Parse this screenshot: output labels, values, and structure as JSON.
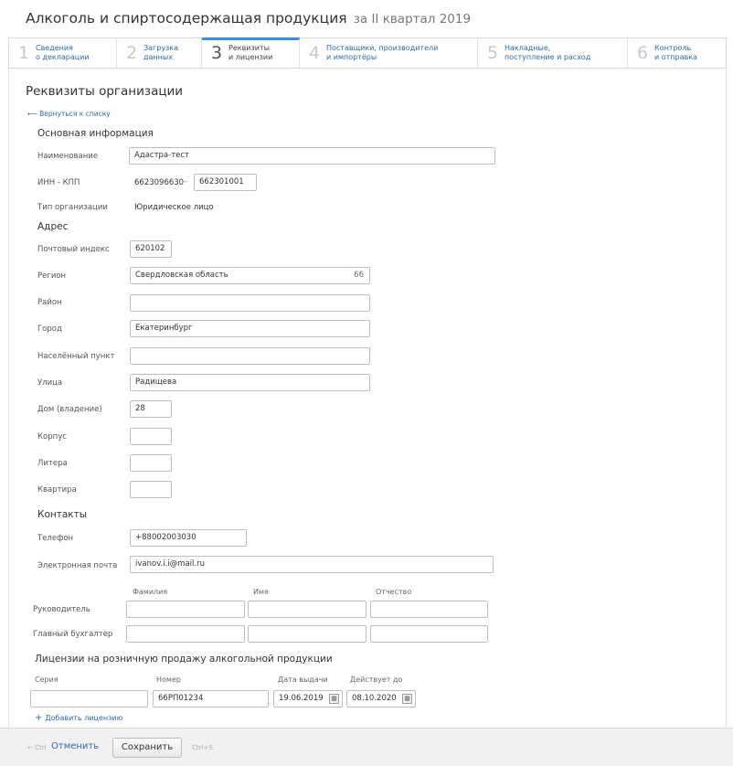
{
  "header": {
    "title": "Алкоголь и спиртосодержащая продукция",
    "period": "за II квартал 2019"
  },
  "steps": [
    {
      "num": "1",
      "label": "Сведения\nо декларации"
    },
    {
      "num": "2",
      "label": "Загрузка\nданных"
    },
    {
      "num": "3",
      "label": "Реквизиты\nи лицензии"
    },
    {
      "num": "4",
      "label": "Поставщики, производители\nи импортёры"
    },
    {
      "num": "5",
      "label": "Накладные,\nпоступление и расход"
    },
    {
      "num": "6",
      "label": "Контроль\nи отправка"
    }
  ],
  "page": {
    "title": "Реквизиты организации",
    "back_link": "Вернуться к списку"
  },
  "basic": {
    "heading": "Основная информация",
    "name_label": "Наименование",
    "name_value": "Адастра-тест",
    "inn_kpp_label": "ИНН - КПП",
    "inn_value": "6623096630",
    "dash": "–",
    "kpp_value": "662301001",
    "org_type_label": "Тип организации",
    "org_type_value": "Юридическое лицо"
  },
  "address": {
    "heading": "Адрес",
    "postal_label": "Почтовый индекс",
    "postal_value": "620102",
    "region_label": "Регион",
    "region_value": "Свердловская область",
    "region_code": "66",
    "district_label": "Район",
    "district_value": "",
    "city_label": "Город",
    "city_value": "Екатеринбург",
    "locality_label": "Населённый пункт",
    "locality_value": "",
    "street_label": "Улица",
    "street_value": "Радищева",
    "house_label": "Дом (владение)",
    "house_value": "28",
    "building_label": "Корпус",
    "building_value": "",
    "letter_label": "Литера",
    "letter_value": "",
    "apartment_label": "Квартира",
    "apartment_value": ""
  },
  "contacts": {
    "heading": "Контакты",
    "phone_label": "Телефон",
    "phone_value": "+88002003030",
    "email_label": "Электронная почта",
    "email_value": "ivanov.i.i@mail.ru",
    "col_lastname": "Фамилия",
    "col_firstname": "Имя",
    "col_patronymic": "Отчество",
    "director_label": "Руководитель",
    "accountant_label": "Главный бухгалтер"
  },
  "licenses": {
    "heading": "Лицензии на розничную продажу алкогольной продукции",
    "col_series": "Серия",
    "col_number": "Номер",
    "col_issue_date": "Дата выдачи",
    "col_valid_until": "Действует до",
    "series_value": "",
    "number_value": "66РП01234",
    "issue_date_value": "19.06.2019",
    "valid_until_value": "08.10.2020",
    "add_label": "Добавить лицензию"
  },
  "footer": {
    "cancel_hint": "Ctrl",
    "cancel_label": "Отменить",
    "save_label": "Сохранить",
    "save_hint": "Ctrl+S"
  },
  "colors": {
    "accent": "#3a8ee6",
    "link": "#2f6aa8"
  }
}
